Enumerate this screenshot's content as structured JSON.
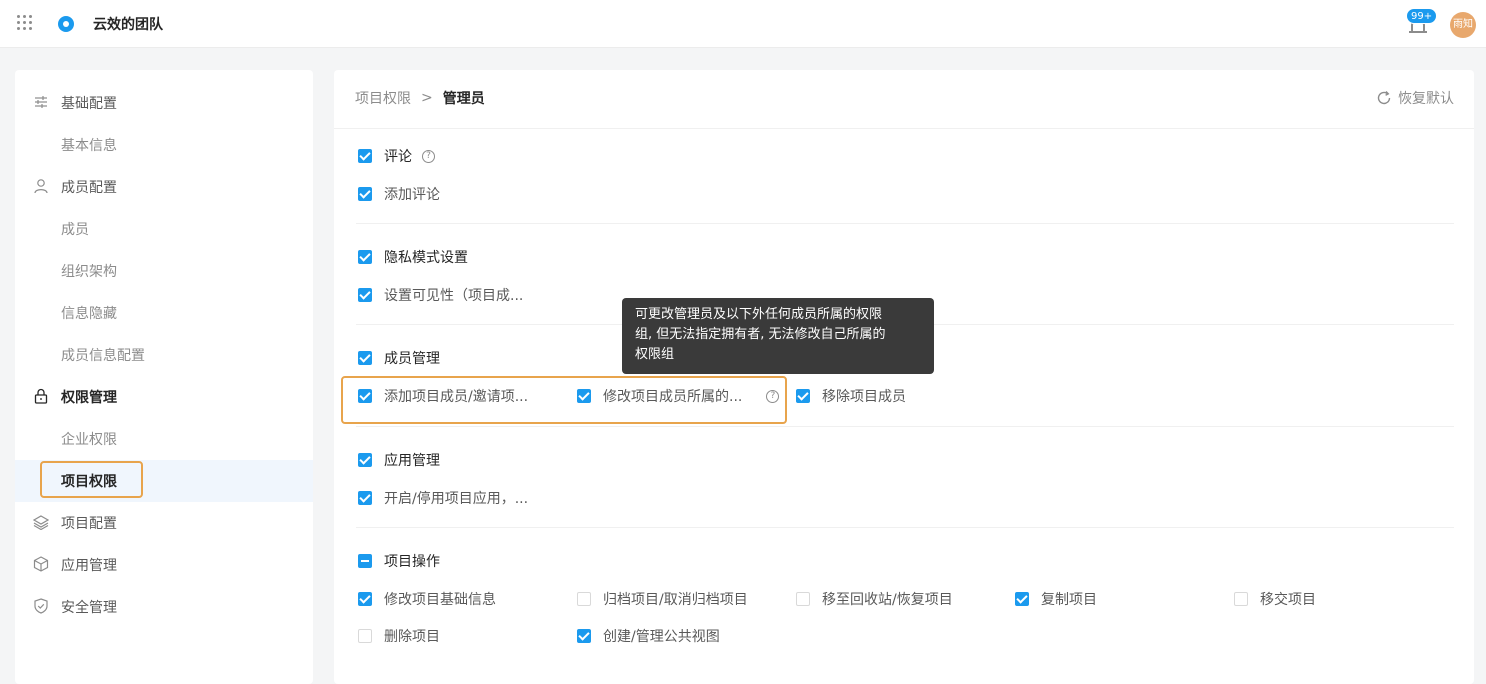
{
  "header": {
    "team_name": "云效的团队",
    "notification_count": "99+",
    "avatar_text": "雨知",
    "icons": [
      "apps-grid-icon",
      "team-logo-icon",
      "bell-icon"
    ]
  },
  "sidebar": {
    "groups": [
      {
        "label": "基础配置",
        "icon": "sliders-icon",
        "items": [
          "基本信息"
        ]
      },
      {
        "label": "成员配置",
        "icon": "user-icon",
        "items": [
          "成员",
          "组织架构",
          "信息隐藏",
          "成员信息配置"
        ]
      },
      {
        "label": "权限管理",
        "icon": "lock-icon",
        "items": [
          "企业权限",
          "项目权限"
        ]
      },
      {
        "label": "项目配置",
        "icon": "layers-icon",
        "items": []
      },
      {
        "label": "应用管理",
        "icon": "cube-icon",
        "items": []
      },
      {
        "label": "安全管理",
        "icon": "shield-icon",
        "items": []
      }
    ],
    "active_item": "项目权限"
  },
  "breadcrumb": {
    "parent": "项目权限",
    "separator": ">",
    "current": "管理员"
  },
  "reset_label": "恢复默认",
  "sections": [
    {
      "title": "评论",
      "state": "checked",
      "has_help": true,
      "permissions": [
        {
          "label": "添加评论",
          "state": "checked"
        }
      ]
    },
    {
      "title": "隐私模式设置",
      "state": "checked",
      "permissions": [
        {
          "label": "设置可见性（项目成...",
          "state": "checked"
        }
      ]
    },
    {
      "title": "成员管理",
      "state": "checked",
      "permissions": [
        {
          "label": "添加项目成员/邀请项...",
          "state": "checked"
        },
        {
          "label": "修改项目成员所属的...",
          "state": "checked",
          "has_help": true
        },
        {
          "label": "移除项目成员",
          "state": "checked"
        }
      ]
    },
    {
      "title": "应用管理",
      "state": "checked",
      "permissions": [
        {
          "label": "开启/停用项目应用，...",
          "state": "checked"
        }
      ]
    },
    {
      "title": "项目操作",
      "state": "indeterminate",
      "permissions": [
        {
          "label": "修改项目基础信息",
          "state": "checked"
        },
        {
          "label": "归档项目/取消归档项目",
          "state": "unchecked"
        },
        {
          "label": "移至回收站/恢复项目",
          "state": "unchecked"
        },
        {
          "label": "复制项目",
          "state": "checked"
        },
        {
          "label": "移交项目",
          "state": "unchecked"
        },
        {
          "label": "删除项目",
          "state": "unchecked"
        },
        {
          "label": "创建/管理公共视图",
          "state": "checked"
        }
      ]
    }
  ],
  "tooltip": {
    "lines": [
      "可更改管理员及以下外任何成员所属的权限",
      "组, 但无法指定拥有者, 无法修改自己所属的",
      "权限组"
    ]
  },
  "colors": {
    "accent": "#1b9aee",
    "highlight": "#e8a44c",
    "tooltip_bg": "#3a3a3a",
    "avatar": "#e8a86d"
  }
}
